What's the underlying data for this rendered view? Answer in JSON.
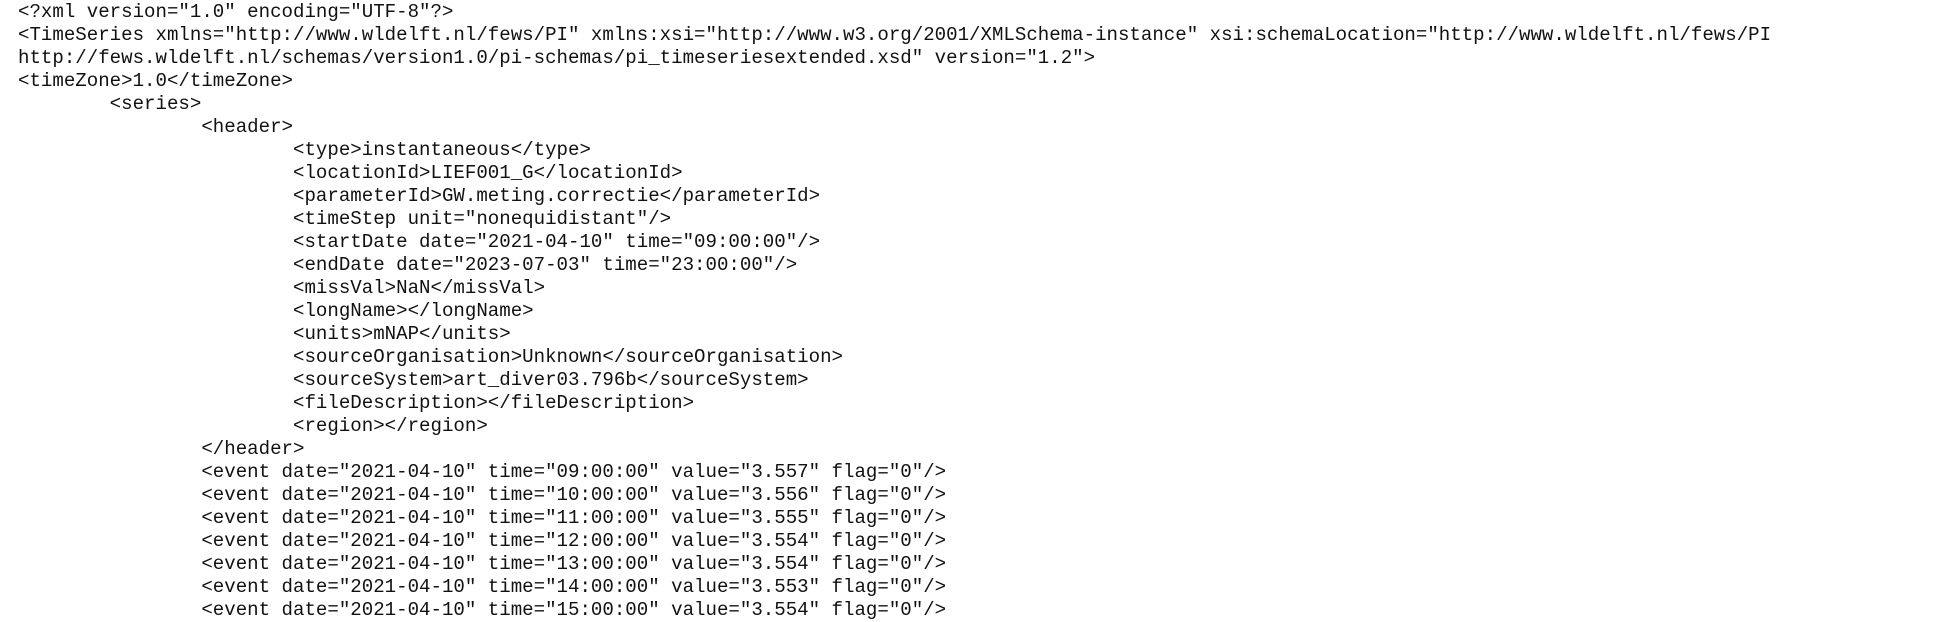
{
  "document": {
    "lines": [
      "<?xml version=\"1.0\" encoding=\"UTF-8\"?>",
      "<TimeSeries xmlns=\"http://www.wldelft.nl/fews/PI\" xmlns:xsi=\"http://www.w3.org/2001/XMLSchema-instance\" xsi:schemaLocation=\"http://www.wldelft.nl/fews/PI",
      "http://fews.wldelft.nl/schemas/version1.0/pi-schemas/pi_timeseriesextended.xsd\" version=\"1.2\">",
      "<timeZone>1.0</timeZone>",
      "\t<series>",
      "\t\t<header>",
      "\t\t\t<type>instantaneous</type>",
      "\t\t\t<locationId>LIEF001_G</locationId>",
      "\t\t\t<parameterId>GW.meting.correctie</parameterId>",
      "\t\t\t<timeStep unit=\"nonequidistant\"/>",
      "\t\t\t<startDate date=\"2021-04-10\" time=\"09:00:00\"/>",
      "\t\t\t<endDate date=\"2023-07-03\" time=\"23:00:00\"/>",
      "\t\t\t<missVal>NaN</missVal>",
      "\t\t\t<longName></longName>",
      "\t\t\t<units>mNAP</units>",
      "\t\t\t<sourceOrganisation>Unknown</sourceOrganisation>",
      "\t\t\t<sourceSystem>art_diver03.796b</sourceSystem>",
      "\t\t\t<fileDescription></fileDescription>",
      "\t\t\t<region></region>",
      "\t\t</header>",
      "\t\t<event date=\"2021-04-10\" time=\"09:00:00\" value=\"3.557\" flag=\"0\"/>",
      "\t\t<event date=\"2021-04-10\" time=\"10:00:00\" value=\"3.556\" flag=\"0\"/>",
      "\t\t<event date=\"2021-04-10\" time=\"11:00:00\" value=\"3.555\" flag=\"0\"/>",
      "\t\t<event date=\"2021-04-10\" time=\"12:00:00\" value=\"3.554\" flag=\"0\"/>",
      "\t\t<event date=\"2021-04-10\" time=\"13:00:00\" value=\"3.554\" flag=\"0\"/>",
      "\t\t<event date=\"2021-04-10\" time=\"14:00:00\" value=\"3.553\" flag=\"0\"/>",
      "\t\t<event date=\"2021-04-10\" time=\"15:00:00\" value=\"3.554\" flag=\"0\"/>"
    ]
  }
}
